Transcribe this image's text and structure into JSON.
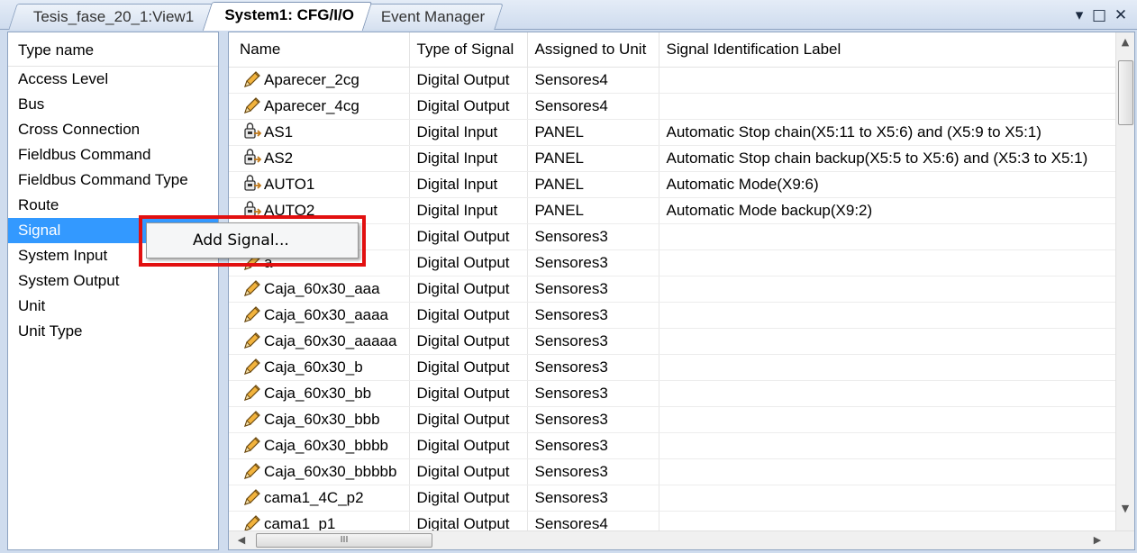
{
  "tabs": [
    {
      "label": "Tesis_fase_20_1:View1",
      "active": false
    },
    {
      "label": "System1: CFG/I/O",
      "active": true
    },
    {
      "label": "Event Manager",
      "active": false
    }
  ],
  "window_controls": {
    "dropdown": "▾",
    "maximize": "□",
    "close": "✕"
  },
  "left_panel": {
    "header": "Type name",
    "items": [
      "Access Level",
      "Bus",
      "Cross Connection",
      "Fieldbus Command",
      "Fieldbus Command Type",
      "Route",
      "Signal",
      "System Input",
      "System Output",
      "Unit",
      "Unit Type"
    ],
    "selected": "Signal"
  },
  "grid": {
    "columns": [
      "Name",
      "Type of Signal",
      "Assigned to Unit",
      "Signal Identification Label"
    ],
    "rows": [
      {
        "icon": "pencil-icon",
        "name": "Aparecer_2cg",
        "type": "Digital Output",
        "unit": "Sensores4",
        "label": ""
      },
      {
        "icon": "pencil-icon",
        "name": "Aparecer_4cg",
        "type": "Digital Output",
        "unit": "Sensores4",
        "label": ""
      },
      {
        "icon": "lock-signal-icon",
        "name": "AS1",
        "type": "Digital Input",
        "unit": "PANEL",
        "label": "Automatic Stop chain(X5:11 to X5:6) and (X5:9 to X5:1)"
      },
      {
        "icon": "lock-signal-icon",
        "name": "AS2",
        "type": "Digital Input",
        "unit": "PANEL",
        "label": "Automatic Stop chain backup(X5:5 to X5:6) and (X5:3 to X5:1)"
      },
      {
        "icon": "lock-signal-icon",
        "name": "AUTO1",
        "type": "Digital Input",
        "unit": "PANEL",
        "label": "Automatic Mode(X9:6)"
      },
      {
        "icon": "lock-signal-icon",
        "name": "AUTO2",
        "type": "Digital Input",
        "unit": "PANEL",
        "label": "Automatic Mode backup(X9:2)"
      },
      {
        "icon": "pencil-icon",
        "name": "",
        "type": "Digital Output",
        "unit": "Sensores3",
        "label": ""
      },
      {
        "icon": "pencil-icon",
        "name": "a",
        "type": "Digital Output",
        "unit": "Sensores3",
        "label": ""
      },
      {
        "icon": "pencil-icon",
        "name": "Caja_60x30_aaa",
        "type": "Digital Output",
        "unit": "Sensores3",
        "label": ""
      },
      {
        "icon": "pencil-icon",
        "name": "Caja_60x30_aaaa",
        "type": "Digital Output",
        "unit": "Sensores3",
        "label": ""
      },
      {
        "icon": "pencil-icon",
        "name": "Caja_60x30_aaaaa",
        "type": "Digital Output",
        "unit": "Sensores3",
        "label": ""
      },
      {
        "icon": "pencil-icon",
        "name": "Caja_60x30_b",
        "type": "Digital Output",
        "unit": "Sensores3",
        "label": ""
      },
      {
        "icon": "pencil-icon",
        "name": "Caja_60x30_bb",
        "type": "Digital Output",
        "unit": "Sensores3",
        "label": ""
      },
      {
        "icon": "pencil-icon",
        "name": "Caja_60x30_bbb",
        "type": "Digital Output",
        "unit": "Sensores3",
        "label": ""
      },
      {
        "icon": "pencil-icon",
        "name": "Caja_60x30_bbbb",
        "type": "Digital Output",
        "unit": "Sensores3",
        "label": ""
      },
      {
        "icon": "pencil-icon",
        "name": "Caja_60x30_bbbbb",
        "type": "Digital Output",
        "unit": "Sensores3",
        "label": ""
      },
      {
        "icon": "pencil-icon",
        "name": "cama1_4C_p2",
        "type": "Digital Output",
        "unit": "Sensores3",
        "label": ""
      },
      {
        "icon": "pencil-icon",
        "name": "cama1_p1",
        "type": "Digital Output",
        "unit": "Sensores4",
        "label": ""
      }
    ]
  },
  "context_menu": {
    "item": "Add Signal...",
    "highlight_color": "#e21010"
  },
  "scrollbar": {
    "h_thumb_grip": "III"
  },
  "colors": {
    "selection": "#3399ff",
    "frame": "#cfdcee"
  }
}
